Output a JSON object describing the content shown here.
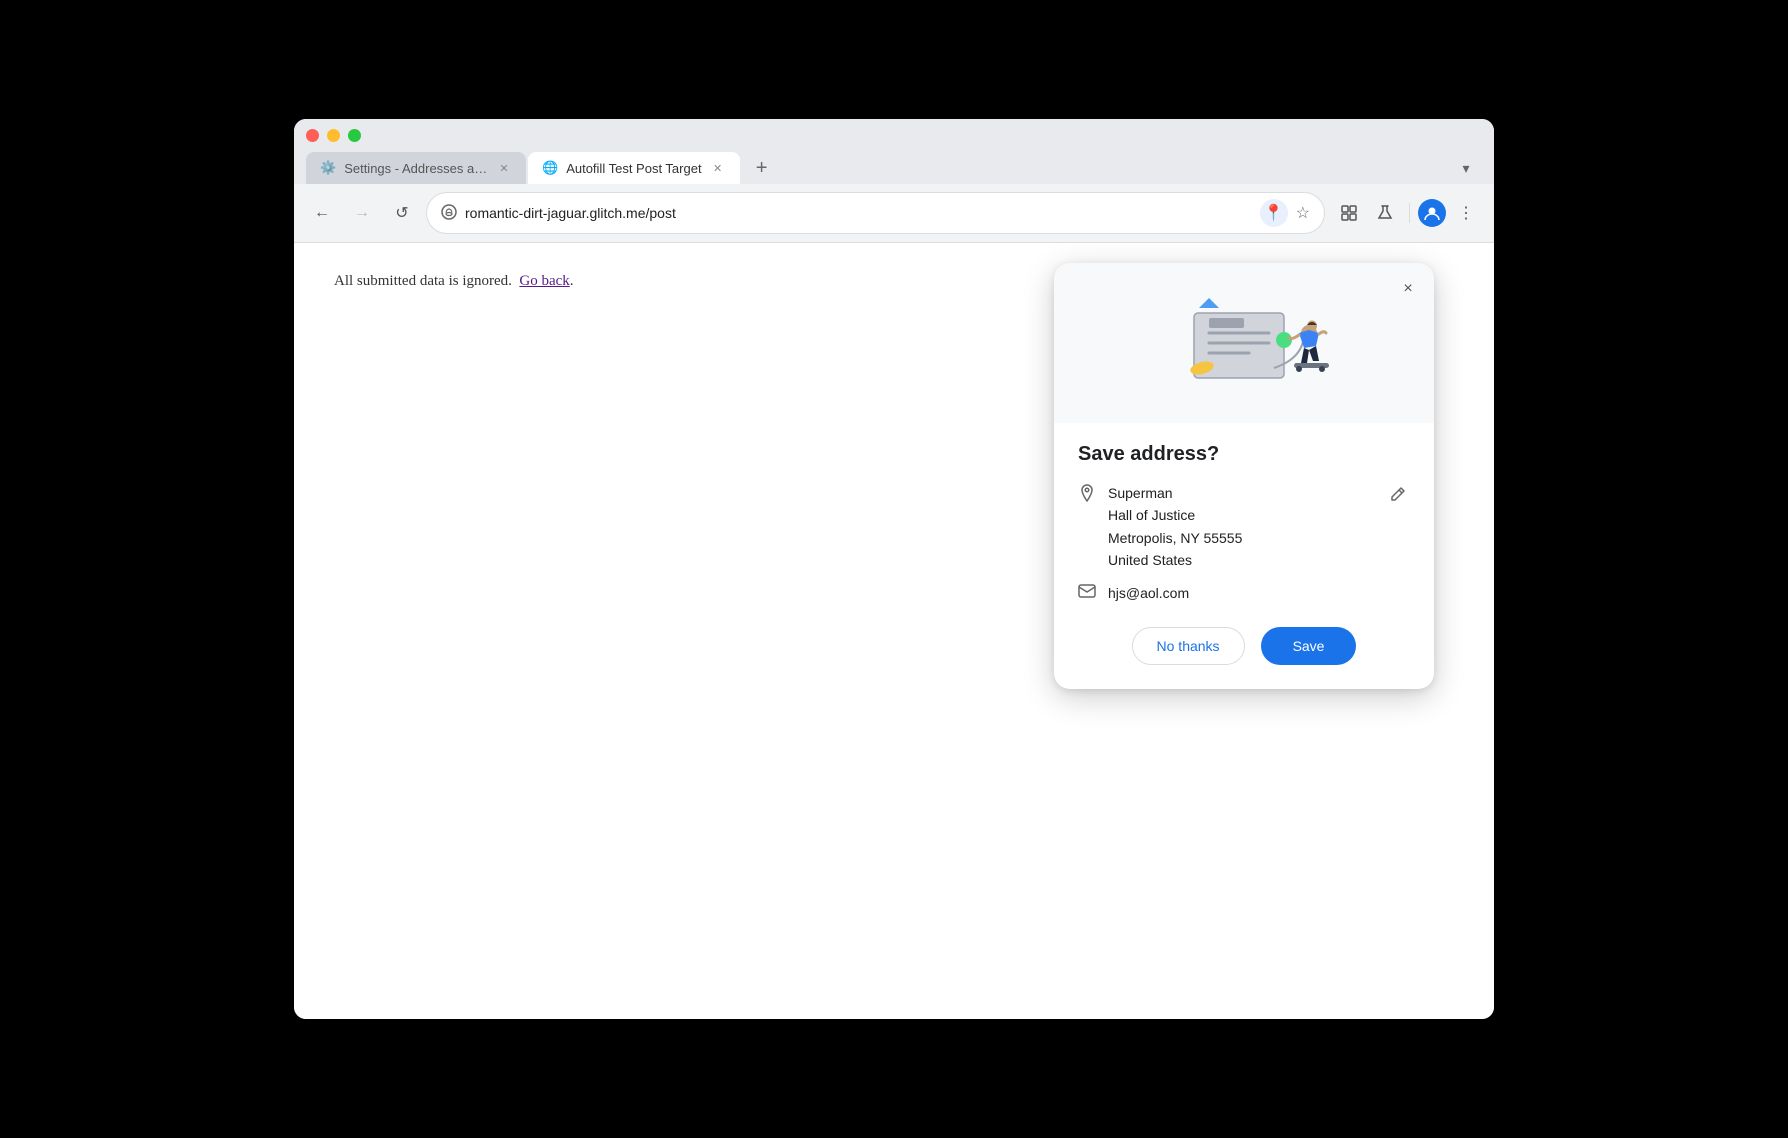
{
  "browser": {
    "tabs": [
      {
        "id": "settings-tab",
        "icon": "⚙️",
        "title": "Settings - Addresses and mo",
        "active": false
      },
      {
        "id": "autofill-tab",
        "icon": "🌐",
        "title": "Autofill Test Post Target",
        "active": true
      }
    ],
    "new_tab_label": "+",
    "dropdown_label": "▾",
    "url": "romantic-dirt-jaguar.glitch.me/post",
    "back_disabled": false,
    "nav": {
      "back": "←",
      "forward": "→",
      "reload": "↺"
    }
  },
  "page": {
    "content": "All submitted data is ignored.",
    "link_text": "Go back",
    "period": "."
  },
  "popup": {
    "title": "Save address?",
    "close_label": "×",
    "address": {
      "name": "Superman",
      "line1": "Hall of Justice",
      "line2": "Metropolis, NY 55555",
      "country": "United States"
    },
    "email": "hjs@aol.com",
    "actions": {
      "no_thanks": "No thanks",
      "save": "Save"
    }
  }
}
